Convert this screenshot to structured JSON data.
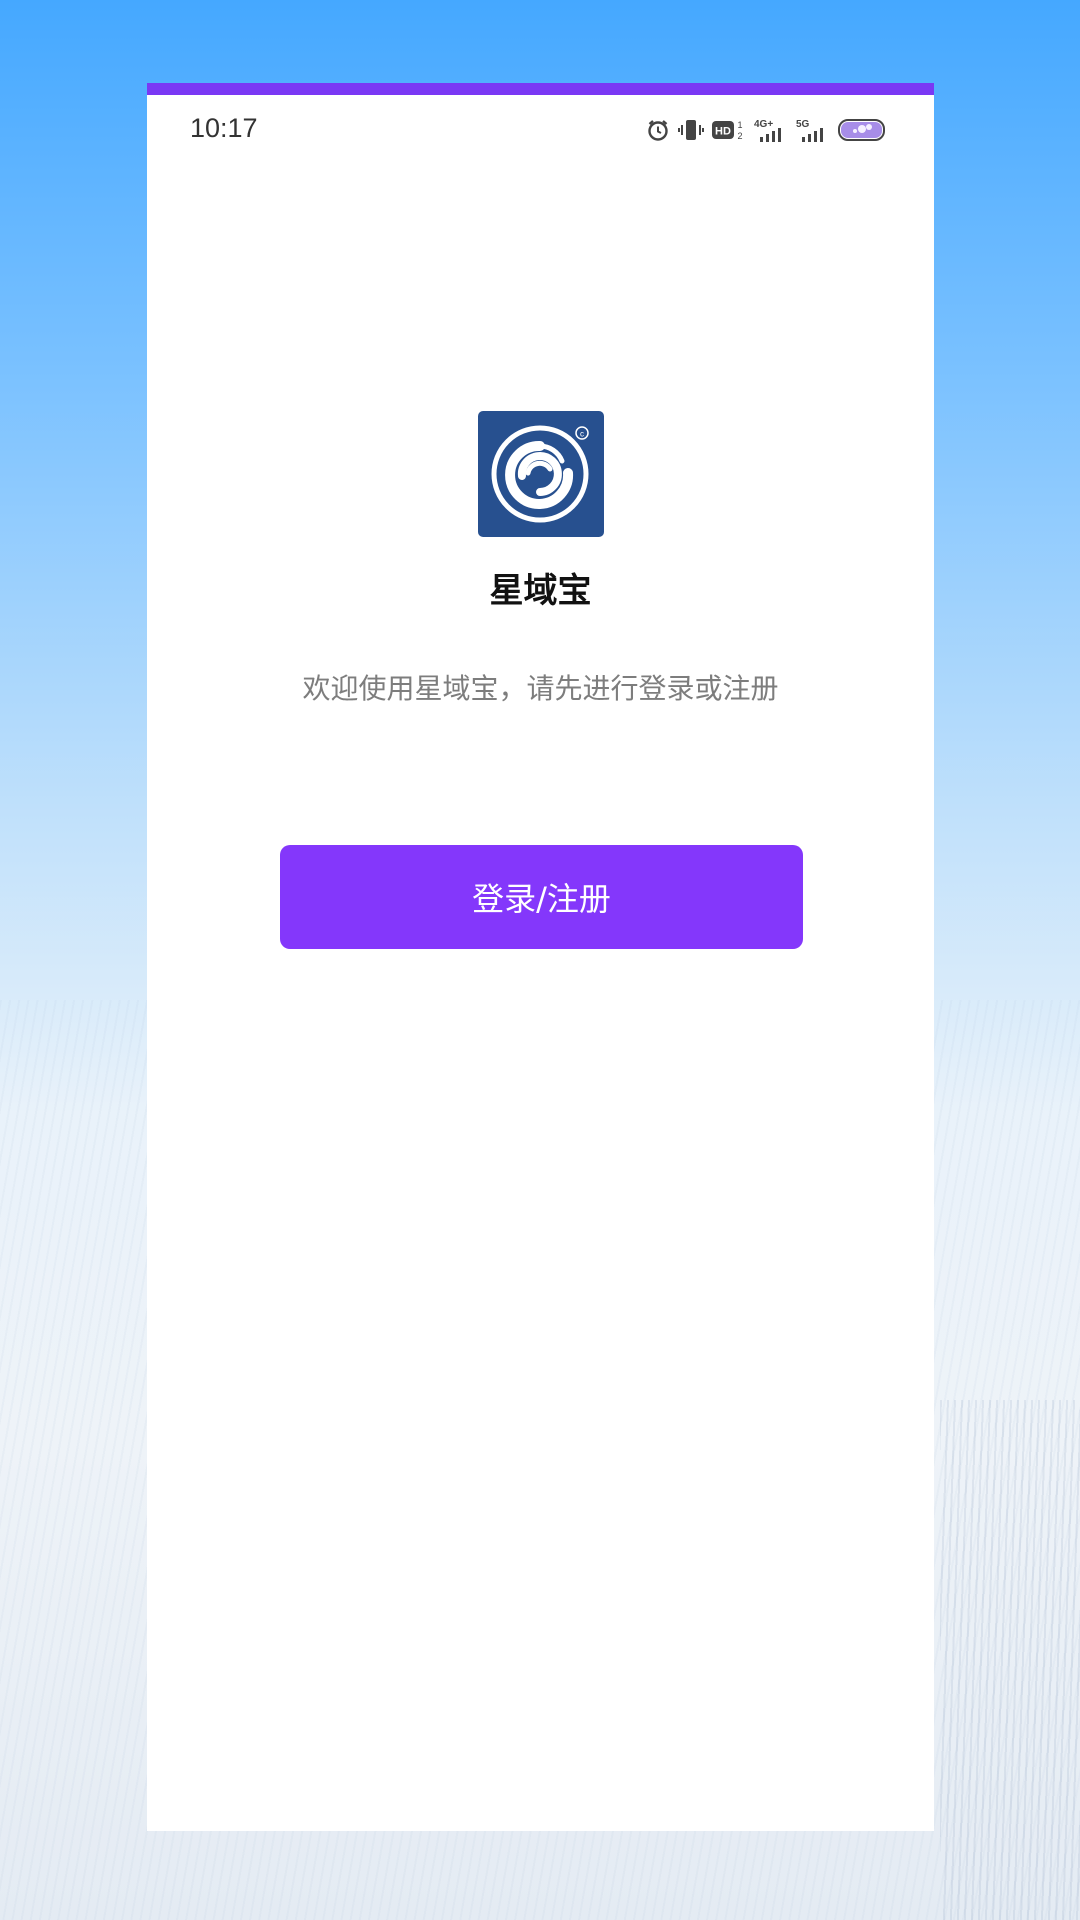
{
  "status_bar": {
    "time": "10:17",
    "icons": [
      "alarm-icon",
      "vibrate-icon",
      "hd-icon",
      "signal-4g-icon",
      "signal-5g-icon",
      "battery-icon"
    ],
    "hd_label": "HD",
    "net1": "4G+",
    "net2": "5G"
  },
  "app": {
    "name": "星域宝",
    "welcome": "欢迎使用星域宝，请先进行登录或注册",
    "login_label": "登录/注册"
  },
  "colors": {
    "accent": "#8437fb",
    "top_border": "#7a38f4",
    "logo_bg": "#27508f"
  }
}
